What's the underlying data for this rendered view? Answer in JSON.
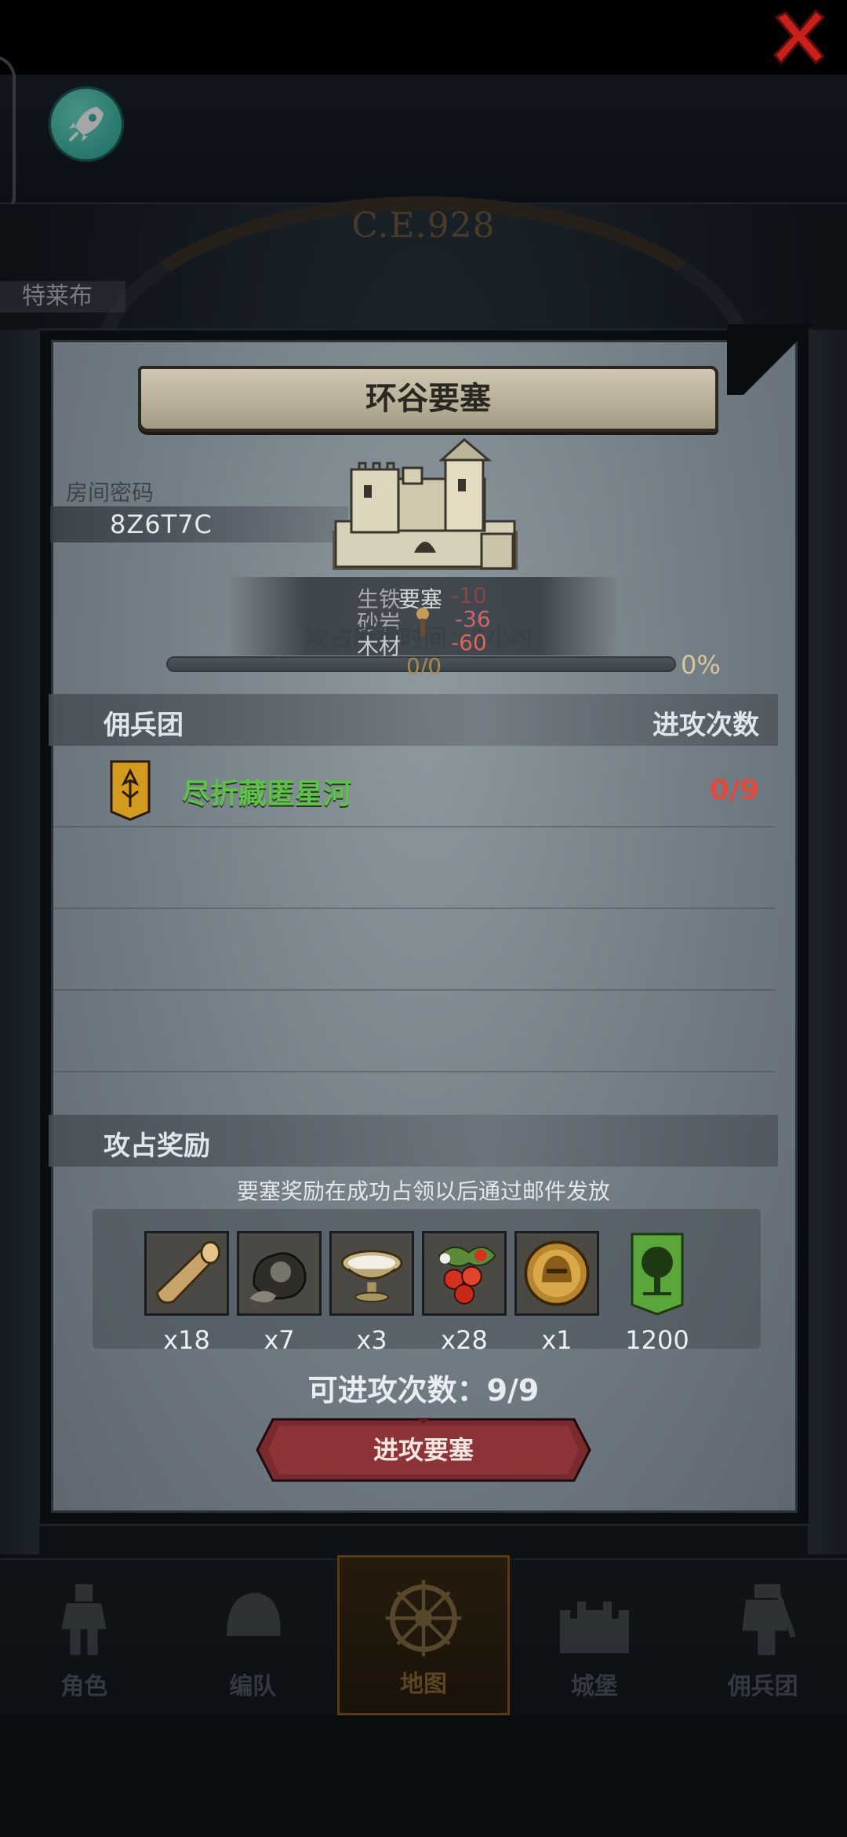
{
  "background": {
    "era_label": "C.E.928",
    "left_tag": "特莱布"
  },
  "nav": {
    "items": [
      {
        "label": "角色",
        "icon": "knight-icon"
      },
      {
        "label": "编队",
        "icon": "helmet-icon"
      },
      {
        "label": "地图",
        "icon": "compass-icon",
        "active": true
      },
      {
        "label": "城堡",
        "icon": "castle-icon"
      },
      {
        "label": "佣兵团",
        "icon": "mercenary-icon"
      }
    ]
  },
  "dialog": {
    "title": "环谷要塞",
    "room_label": "房间密码",
    "room_code": "8Z6T7C",
    "fortress_label": "要塞",
    "resources": {
      "iron_label": "生铁",
      "iron_value": "-10",
      "sand_label": "砂岩",
      "sand_value": "-36",
      "wood_label": "木材",
      "wood_value": "-60"
    },
    "occupy_time": "攻占所需时间：5小时",
    "progress": {
      "count": "0/0",
      "percent": "0%",
      "fraction": 0
    },
    "mercs_section": {
      "label": "佣兵团",
      "attacks_header": "进攻次数",
      "rows": [
        {
          "name": "尽折藏匿星河",
          "attacks": "0/9"
        }
      ]
    },
    "rewards_section": {
      "label": "攻占奖励",
      "note": "要塞奖励在成功占领以后通过邮件发放",
      "items": [
        {
          "icon": "wood-log-icon",
          "qty": "x18"
        },
        {
          "icon": "ore-stone-icon",
          "qty": "x7"
        },
        {
          "icon": "bowl-icon",
          "qty": "x3"
        },
        {
          "icon": "berries-icon",
          "qty": "x28"
        },
        {
          "icon": "gold-helmet-coin-icon",
          "qty": "x1"
        },
        {
          "icon": "tree-banner-icon",
          "qty": "1200"
        }
      ]
    },
    "attacks_remaining": "可进攻次数：9/9",
    "attack_button": "进攻要塞"
  },
  "colors": {
    "merc_name": "#5ec24a",
    "attack_count": "#e04a3a",
    "rocket_button": "#3cb7a6",
    "attack_button": "#7a2a2e"
  }
}
